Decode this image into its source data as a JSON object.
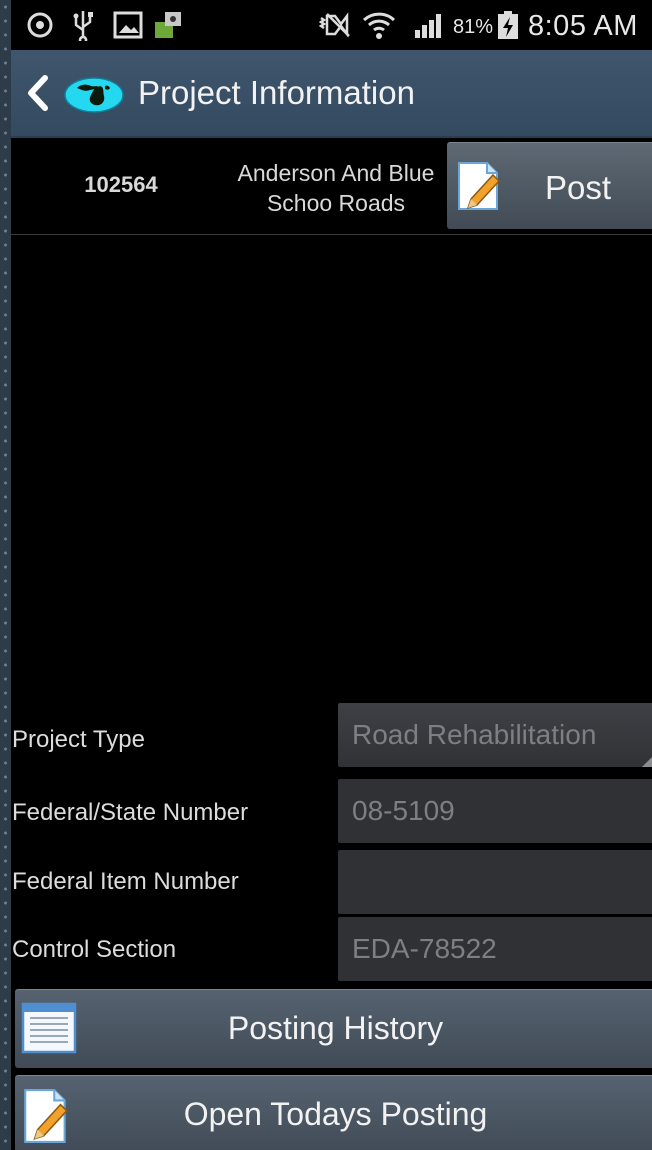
{
  "status_bar": {
    "battery_percent": "81%",
    "time": "8:05 AM",
    "left_icons": [
      "sync-icon",
      "usb-icon",
      "gallery-icon",
      "app-update-icon"
    ],
    "right_icons": [
      "mute-icon",
      "wifi-icon",
      "signal-icon",
      "battery-charging-icon"
    ]
  },
  "action_bar": {
    "title": "Project Information",
    "back_icon": "chevron-left-icon",
    "logo_icon": "michigan-globe-logo"
  },
  "project": {
    "number": "102564",
    "name": "Anderson And Blue Schoo Roads",
    "post_label": "Post"
  },
  "form": {
    "fields": [
      {
        "label": "Project Type",
        "value": "Road Rehabilitation"
      },
      {
        "label": "Federal/State Number",
        "value": "08-5109"
      },
      {
        "label": "Federal Item Number",
        "value": ""
      },
      {
        "label": "Control Section",
        "value": "EDA-78522"
      }
    ]
  },
  "buttons": {
    "posting_history": "Posting History",
    "open_todays_posting": "Open Todays Posting"
  },
  "colors": {
    "action_bar": "#3b5268",
    "button": "#4d5864",
    "field_bg": "#2f3134",
    "field_text": "#7c7f84"
  }
}
